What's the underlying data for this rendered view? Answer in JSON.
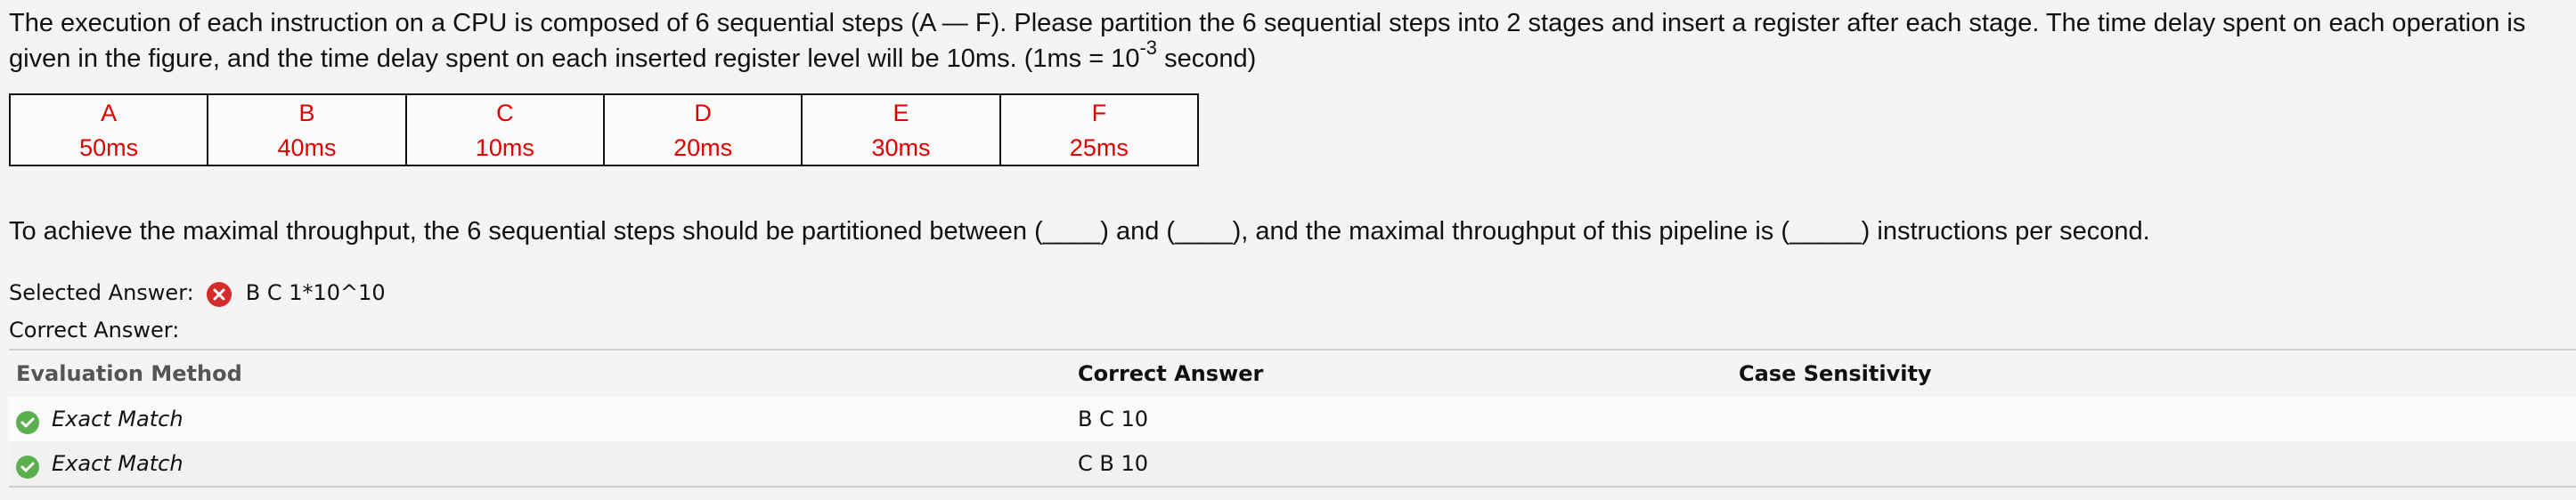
{
  "question": {
    "text_before_sup": "The execution of each instruction on a CPU is composed of 6 sequential steps (A — F). Please partition the 6 sequential steps into 2 stages and insert a register after each stage. The time delay spent on each operation is given in the figure, and the time delay spent on each inserted register level will be 10ms. (1ms = 10",
    "sup": "-3",
    "text_after_sup": " second)"
  },
  "steps": [
    {
      "letter": "A",
      "delay": "50ms"
    },
    {
      "letter": "B",
      "delay": "40ms"
    },
    {
      "letter": "C",
      "delay": "10ms"
    },
    {
      "letter": "D",
      "delay": "20ms"
    },
    {
      "letter": "E",
      "delay": "30ms"
    },
    {
      "letter": "F",
      "delay": "25ms"
    }
  ],
  "colors": {
    "step_text": "#e00000",
    "incorrect_icon": "#d62b2b",
    "correct_icon": "#5bb04d"
  },
  "prompt": "To achieve the maximal throughput, the 6 sequential steps should be partitioned between (____) and (____), and the maximal throughput of this pipeline is (_____) instructions per second.",
  "selected_answer": {
    "label": "Selected Answer:",
    "icon": "incorrect-icon",
    "value": "B C 1*10^10"
  },
  "correct_answer": {
    "label": "Correct Answer:"
  },
  "evaluation_table": {
    "headers": {
      "method": "Evaluation Method",
      "answer": "Correct Answer",
      "case": "Case Sensitivity"
    },
    "rows": [
      {
        "icon": "correct-icon",
        "method": "Exact Match",
        "answer": "B C 10",
        "case": ""
      },
      {
        "icon": "correct-icon",
        "method": "Exact Match",
        "answer": "C B 10",
        "case": ""
      }
    ]
  }
}
